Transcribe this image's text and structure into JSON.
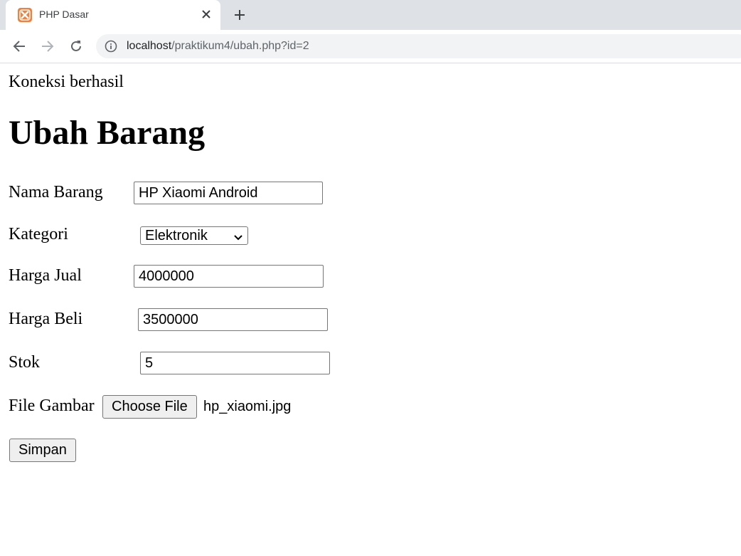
{
  "browser": {
    "tab_title": "PHP Dasar",
    "url_host": "localhost",
    "url_path": "/praktikum4/ubah.php?id=2"
  },
  "page": {
    "status_text": "Koneksi berhasil",
    "heading": "Ubah Barang"
  },
  "form": {
    "nama_label": "Nama Barang",
    "nama_value": "HP Xiaomi Android",
    "kategori_label": "Kategori",
    "kategori_value": "Elektronik",
    "harga_jual_label": "Harga Jual",
    "harga_jual_value": "4000000",
    "harga_beli_label": "Harga Beli",
    "harga_beli_value": "3500000",
    "stok_label": "Stok",
    "stok_value": "5",
    "file_label": "File Gambar",
    "choose_file_label": "Choose File",
    "file_name": "hp_xiaomi.jpg",
    "submit_label": "Simpan"
  },
  "colors": {
    "tab_bar": "#dee1e6",
    "favicon": "#f0803c",
    "omnibox": "#f1f3f4"
  },
  "icons": [
    "xampp-favicon-icon",
    "close-icon",
    "plus-icon",
    "back-arrow-icon",
    "forward-arrow-icon",
    "reload-icon",
    "info-icon",
    "chevron-down-icon"
  ]
}
